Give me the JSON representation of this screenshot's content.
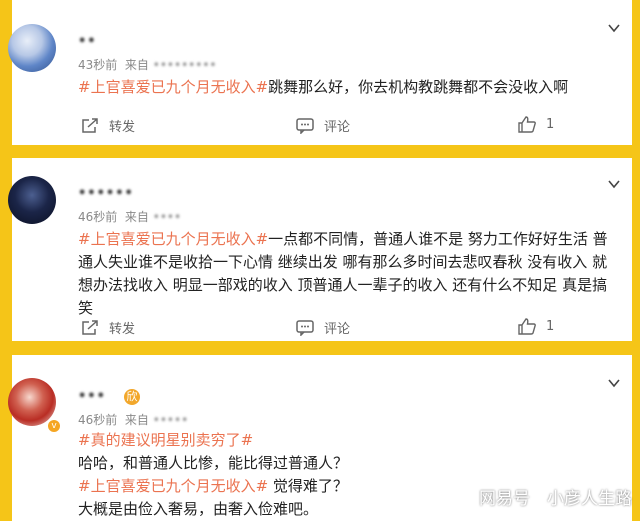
{
  "comments": [
    {
      "name": "••",
      "time": "43秒前",
      "source_prefix": "来自",
      "source_blurred": "•••••••••",
      "tag": "#上官喜爱已九个月无收入#",
      "text": "跳舞那么好，你去机构教跳舞都不会没收入啊",
      "actions": {
        "repost": "转发",
        "comment": "评论",
        "like_count": "1"
      }
    },
    {
      "name": "••••••",
      "time": "46秒前",
      "source_prefix": "来自",
      "source_blurred": "••••",
      "tag": "#上官喜爱已九个月无收入#",
      "text": "一点都不同情，普通人谁不是 努力工作好好生活 普通人失业谁不是收拾一下心情 继续出发 哪有那么多时间去悲叹春秋 没有收入 就想办法找收入 明显一部戏的收入 顶普通人一辈子的收入 还有什么不知足 真是搞笑",
      "actions": {
        "repost": "转发",
        "comment": "评论",
        "like_count": "1"
      }
    },
    {
      "name": "•••",
      "time": "46秒前",
      "source_prefix": "来自",
      "source_blurred": "•••••",
      "tag1": "#真的建议明星别卖穷了#",
      "line1": "哈哈，和普通人比惨，能比得过普通人？",
      "tag2": "#上官喜爱已九个月无收入#",
      "line2_rest": " 觉得难了？",
      "line3": "大概是由俭入奢易，由奢入俭难吧。",
      "badge": "欣"
    }
  ],
  "watermark": {
    "brand": "网易号",
    "account": "小彦人生路"
  },
  "colors": {
    "background": "#f5c518",
    "tag": "#eb7350"
  }
}
